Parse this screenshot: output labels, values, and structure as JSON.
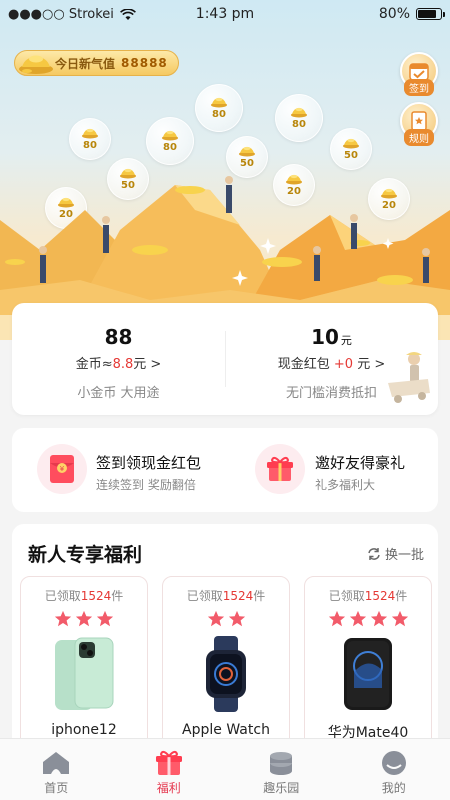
{
  "status_bar": {
    "carrier": "●●●○○ Strokei",
    "time": "1:43 pm",
    "battery": "80%",
    "battery_level": 0.8
  },
  "hero": {
    "value_label": "今日新气值",
    "value_number": "88888",
    "checkin_label": "签到",
    "rules_label": "规则",
    "bubbles": [
      "80",
      "80",
      "50",
      "80",
      "50",
      "80",
      "50",
      "20",
      "20",
      "20",
      "20"
    ]
  },
  "wallet": {
    "coins": {
      "value": "88",
      "line_label": "金币≈",
      "approx": "8.8",
      "unit_suffix": "元 >",
      "desc": "小金币 大用途"
    },
    "cash": {
      "value": "10",
      "unit": "元",
      "line_label": "现金红包",
      "delta": "+0",
      "unit_suffix": " 元 >",
      "desc": "无门槛消费抵扣"
    }
  },
  "actions": [
    {
      "title": "签到领现金红包",
      "subtitle": "连续签到 奖励翻倍",
      "icon": "red-envelope-icon"
    },
    {
      "title": "邀好友得豪礼",
      "subtitle": "礼多福利大",
      "icon": "gift-icon"
    }
  ],
  "newbie": {
    "title": "新人专享福利",
    "refresh_label": "换一批",
    "products": [
      {
        "claimed_prefix": "已领取",
        "claimed_count": "1524",
        "claimed_suffix": "件",
        "stars": 3,
        "name": "iphone12",
        "color": "#b7e0c9"
      },
      {
        "claimed_prefix": "已领取",
        "claimed_count": "1524",
        "claimed_suffix": "件",
        "stars": 2,
        "name": "Apple Watch",
        "color": "#2b3a5c"
      },
      {
        "claimed_prefix": "已领取",
        "claimed_count": "1524",
        "claimed_suffix": "件",
        "stars": 4,
        "name": "华为Mate40",
        "color": "#1a1a1a"
      }
    ]
  },
  "tabs": [
    {
      "label": "首页",
      "icon": "home-icon",
      "active": false
    },
    {
      "label": "福利",
      "icon": "gift-icon",
      "active": true
    },
    {
      "label": "趣乐园",
      "icon": "coins-stack-icon",
      "active": false
    },
    {
      "label": "我的",
      "icon": "profile-icon",
      "active": false
    }
  ],
  "colors": {
    "accent_red": "#e53950",
    "gold": "#f3c776",
    "card_bg": "#ffffff"
  }
}
